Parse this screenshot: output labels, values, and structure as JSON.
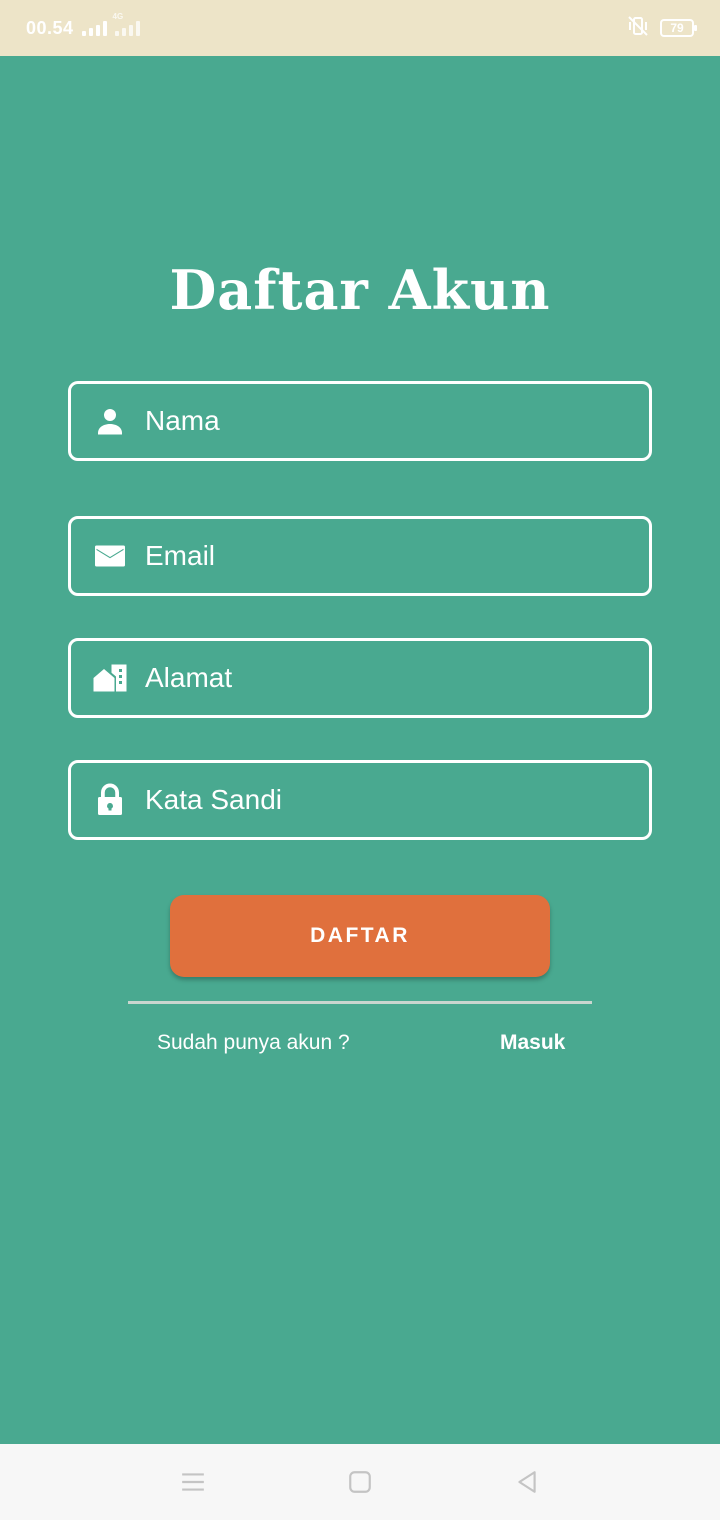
{
  "status_bar": {
    "time": "00.54",
    "network_label": "4G",
    "battery": "79",
    "icons": [
      "signal-icon",
      "signal-4g-icon",
      "vibrate-off-icon",
      "battery-icon"
    ]
  },
  "page": {
    "title": "Daftar Akun"
  },
  "form": {
    "name_placeholder": "Nama",
    "email_placeholder": "Email",
    "address_placeholder": "Alamat",
    "password_placeholder": "Kata Sandi",
    "submit_label": "DAFTAR"
  },
  "footer": {
    "question": "Sudah punya akun ?",
    "login_link": "Masuk"
  },
  "nav": {
    "icons": [
      "menu-icon",
      "home-icon",
      "back-icon"
    ]
  },
  "colors": {
    "background": "#49a990",
    "status_bar": "#ede4c8",
    "button": "#e0703d",
    "text": "#ffffff"
  }
}
